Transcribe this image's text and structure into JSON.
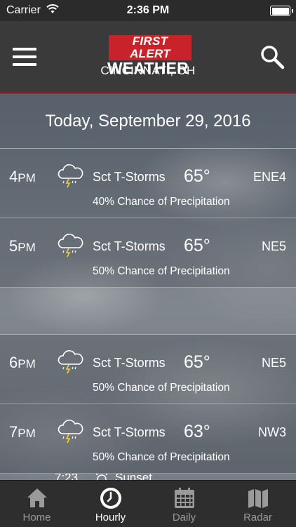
{
  "status_bar": {
    "carrier": "Carrier",
    "time": "2:36 PM"
  },
  "header": {
    "logo_line1": "FIRST ALERT",
    "logo_line2": "WEATHER",
    "location": "CINCINNATI, OH"
  },
  "date_banner": "Today, September 29, 2016",
  "hours": [
    {
      "hour": "4",
      "ampm": "PM",
      "icon": "thunderstorm-cloud-icon",
      "condition": "Sct T-Storms",
      "temp": "65°",
      "wind": "ENE4",
      "precip": "40% Chance of Precipitation"
    },
    {
      "hour": "5",
      "ampm": "PM",
      "icon": "thunderstorm-cloud-icon",
      "condition": "Sct T-Storms",
      "temp": "65°",
      "wind": "NE5",
      "precip": "50% Chance of Precipitation"
    },
    {
      "hour": "6",
      "ampm": "PM",
      "icon": "thunderstorm-cloud-icon",
      "condition": "Sct T-Storms",
      "temp": "65°",
      "wind": "NE5",
      "precip": "50% Chance of Precipitation"
    },
    {
      "hour": "7",
      "ampm": "PM",
      "icon": "thunderstorm-cloud-icon",
      "condition": "Sct T-Storms",
      "temp": "63°",
      "wind": "NW3",
      "precip": "50% Chance of Precipitation"
    }
  ],
  "peek_row": {
    "time": "7:23",
    "label": "Sunset"
  },
  "tabs": [
    {
      "label": "Home",
      "icon": "home-icon",
      "active": false
    },
    {
      "label": "Hourly",
      "icon": "clock-icon",
      "active": true
    },
    {
      "label": "Daily",
      "icon": "calendar-icon",
      "active": false
    },
    {
      "label": "Radar",
      "icon": "map-icon",
      "active": false
    }
  ],
  "colors": {
    "brand_red": "#c8232a",
    "header_bg": "#3a3a3a",
    "tab_bg": "#2e2e2e"
  }
}
